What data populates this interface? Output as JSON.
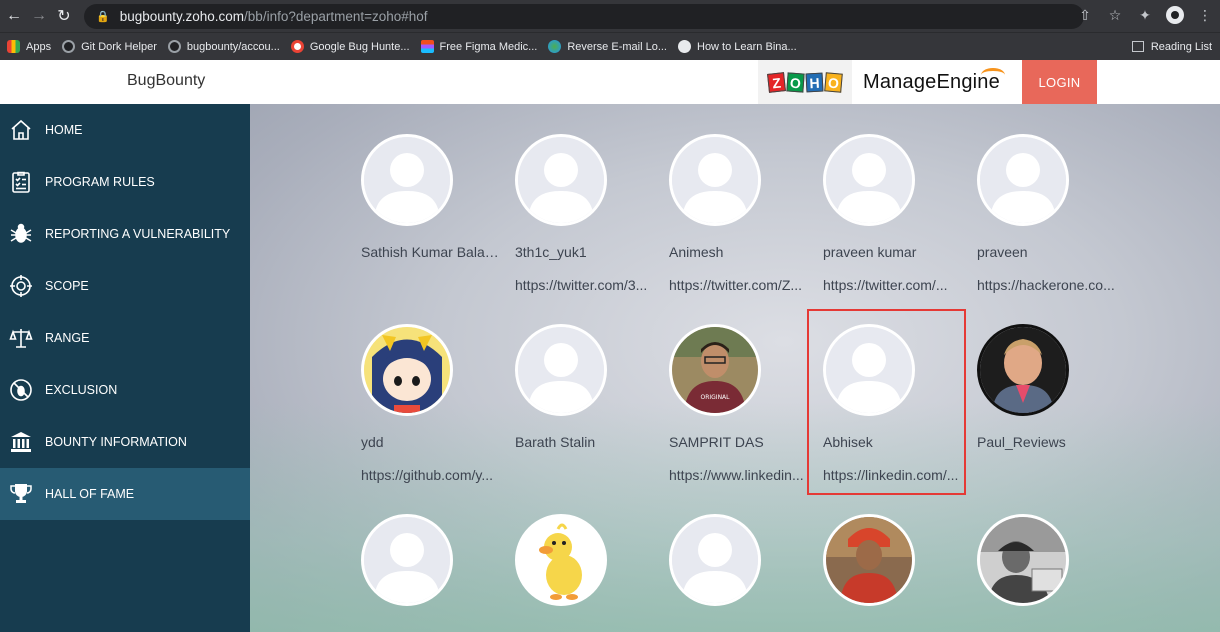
{
  "browser": {
    "url_host": "bugbounty.zoho.com",
    "url_path": "/bb/info?department=zoho#hof",
    "bookmarks": [
      {
        "label": "Apps",
        "icon": "apps-grid-icon"
      },
      {
        "label": "Git Dork Helper",
        "icon": "github-icon"
      },
      {
        "label": "bugbounty/accou...",
        "icon": "github-icon"
      },
      {
        "label": "Google Bug Hunte...",
        "icon": "google-bug-hunters-icon"
      },
      {
        "label": "Free Figma Medic...",
        "icon": "figma-icon"
      },
      {
        "label": "Reverse E-mail Lo...",
        "icon": "globe-icon"
      },
      {
        "label": "How to Learn Bina...",
        "icon": "globe-icon"
      }
    ],
    "reading_list": "Reading List"
  },
  "header": {
    "title": "BugBounty",
    "zoho_letters": [
      "Z",
      "O",
      "H",
      "O"
    ],
    "manage_engine": "ManageEngine",
    "login": "LOGIN"
  },
  "sidebar": {
    "items": [
      {
        "label": "HOME",
        "icon": "home-icon",
        "active": false
      },
      {
        "label": "PROGRAM RULES",
        "icon": "checklist-icon",
        "active": false
      },
      {
        "label": "REPORTING A VULNERABILITY",
        "icon": "bug-icon",
        "active": false
      },
      {
        "label": "SCOPE",
        "icon": "scope-target-icon",
        "active": false
      },
      {
        "label": "RANGE",
        "icon": "scale-icon",
        "active": false
      },
      {
        "label": "EXCLUSION",
        "icon": "exclusion-icon",
        "active": false
      },
      {
        "label": "BOUNTY INFORMATION",
        "icon": "bank-icon",
        "active": false
      },
      {
        "label": "HALL OF FAME",
        "icon": "trophy-icon",
        "active": true
      }
    ]
  },
  "hall_of_fame": {
    "row1": [
      {
        "name": "Sathish Kumar Balak...",
        "link": "",
        "avatar": "default-avatar"
      },
      {
        "name": "3th1c_yuk1",
        "link": "https://twitter.com/3...",
        "avatar": "default-avatar"
      },
      {
        "name": "Animesh",
        "link": "https://twitter.com/Z...",
        "avatar": "default-avatar"
      },
      {
        "name": "praveen kumar",
        "link": "https://twitter.com/...",
        "avatar": "default-avatar"
      },
      {
        "name": "praveen",
        "link": "https://hackerone.co...",
        "avatar": "default-avatar"
      }
    ],
    "row2": [
      {
        "name": "ydd",
        "link": "https://github.com/y...",
        "avatar": "anime-avatar"
      },
      {
        "name": "Barath Stalin",
        "link": "",
        "avatar": "default-avatar"
      },
      {
        "name": "SAMPRIT DAS",
        "link": "https://www.linkedin...",
        "avatar": "photo-avatar"
      },
      {
        "name": "Abhisek",
        "link": "https://linkedin.com/...",
        "avatar": "default-avatar",
        "highlighted": true
      },
      {
        "name": "Paul_Reviews",
        "link": "",
        "avatar": "photo-avatar"
      }
    ],
    "row3": [
      {
        "avatar": "default-avatar"
      },
      {
        "avatar": "duck-avatar"
      },
      {
        "avatar": "default-avatar"
      },
      {
        "avatar": "photo-avatar"
      },
      {
        "avatar": "photo-avatar"
      }
    ]
  },
  "colors": {
    "sidebar_bg": "#173c4f",
    "sidebar_active": "#275b73",
    "login_bg": "#e8685a",
    "highlight_box": "#e53935"
  }
}
